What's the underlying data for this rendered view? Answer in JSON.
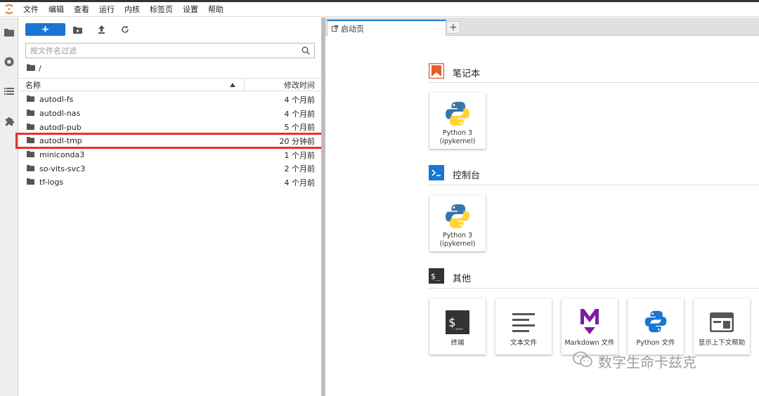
{
  "menubar": {
    "items": [
      "文件",
      "编辑",
      "查看",
      "运行",
      "内核",
      "标签页",
      "设置",
      "帮助"
    ]
  },
  "activity": {
    "icons": [
      "folder-icon",
      "running-icon",
      "toc-icon",
      "extension-icon"
    ]
  },
  "filebrowser": {
    "new_label": "+",
    "filter_placeholder": "按文件名过滤",
    "breadcrumb": "/",
    "col_name": "名称",
    "col_modified": "修改时间",
    "files": [
      {
        "name": "autodl-fs",
        "modified": "4 个月前"
      },
      {
        "name": "autodl-nas",
        "modified": "4 个月前"
      },
      {
        "name": "autodl-pub",
        "modified": "5 个月前"
      },
      {
        "name": "autodl-tmp",
        "modified": "20 分钟前"
      },
      {
        "name": "miniconda3",
        "modified": "1 个月前"
      },
      {
        "name": "so-vits-svc3",
        "modified": "2 个月前"
      },
      {
        "name": "tf-logs",
        "modified": "4 个月前"
      }
    ]
  },
  "tabs": {
    "active_label": "启动页",
    "add_label": "+"
  },
  "launcher": {
    "notebook": {
      "title": "笔记本",
      "cards": [
        {
          "line1": "Python 3",
          "line2": "(ipykernel)"
        }
      ]
    },
    "console": {
      "title": "控制台",
      "cards": [
        {
          "line1": "Python 3",
          "line2": "(ipykernel)"
        }
      ]
    },
    "other": {
      "title": "其他",
      "cards": [
        {
          "label": "终端",
          "icon": "terminal-icon"
        },
        {
          "label": "文本文件",
          "icon": "text-file-icon"
        },
        {
          "label": "Markdown 文件",
          "icon": "markdown-icon"
        },
        {
          "label": "Python 文件",
          "icon": "python-file-icon"
        },
        {
          "label": "显示上下文帮助",
          "icon": "context-help-icon"
        }
      ]
    }
  },
  "watermark": "数字生命卡兹克",
  "colors": {
    "accent": "#1976d2",
    "highlight": "#e8312f",
    "notebook_orange": "#e15d2a"
  }
}
